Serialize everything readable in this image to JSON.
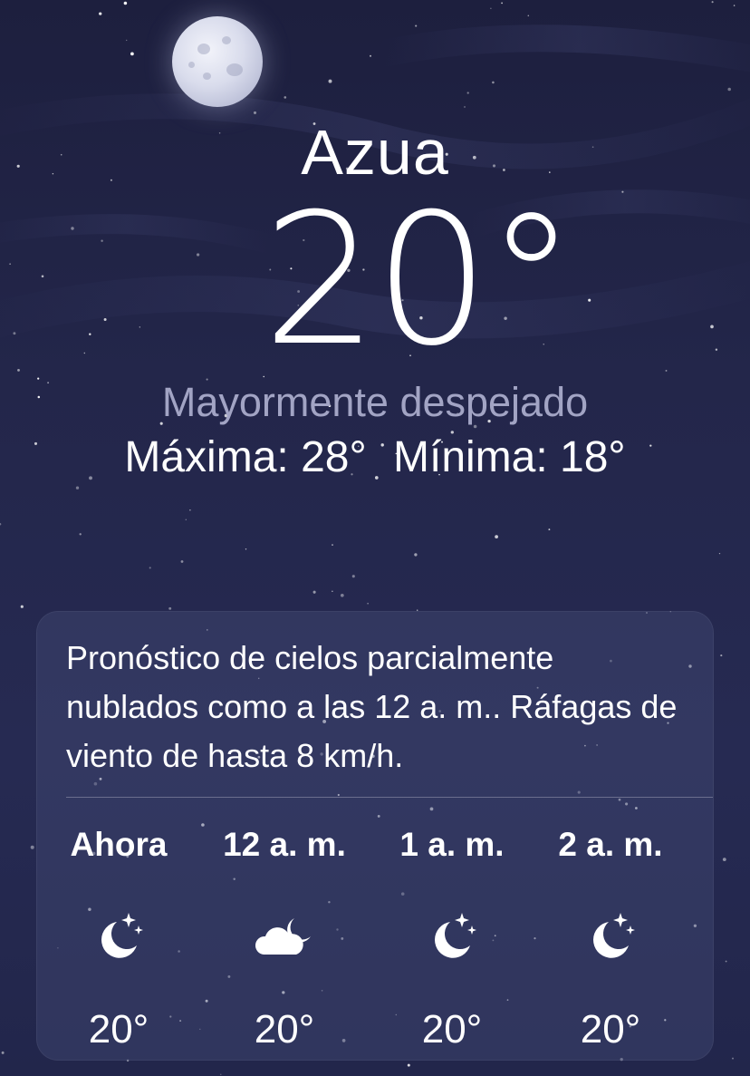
{
  "location": {
    "city": "Azua",
    "temperature": "20°",
    "condition": "Mayormente despejado",
    "high": "Máxima: 28°",
    "low": "Mínima: 18°"
  },
  "forecast_card": {
    "summary": "Pronóstico de cielos parcialmente nublados como a las 12 a. m.. Ráfagas de viento de hasta 8 km/h.",
    "hours": [
      {
        "label": "Ahora",
        "icon": "moon-stars-icon",
        "temp": "20°"
      },
      {
        "label": "12 a. m.",
        "icon": "cloud-moon-icon",
        "temp": "20°"
      },
      {
        "label": "1 a. m.",
        "icon": "moon-stars-icon",
        "temp": "20°"
      },
      {
        "label": "2 a. m.",
        "icon": "moon-stars-icon",
        "temp": "20°"
      }
    ]
  },
  "colors": {
    "background": "#23264a",
    "condition_text": "#a2a4c4",
    "card_background": "#3a3f64"
  }
}
